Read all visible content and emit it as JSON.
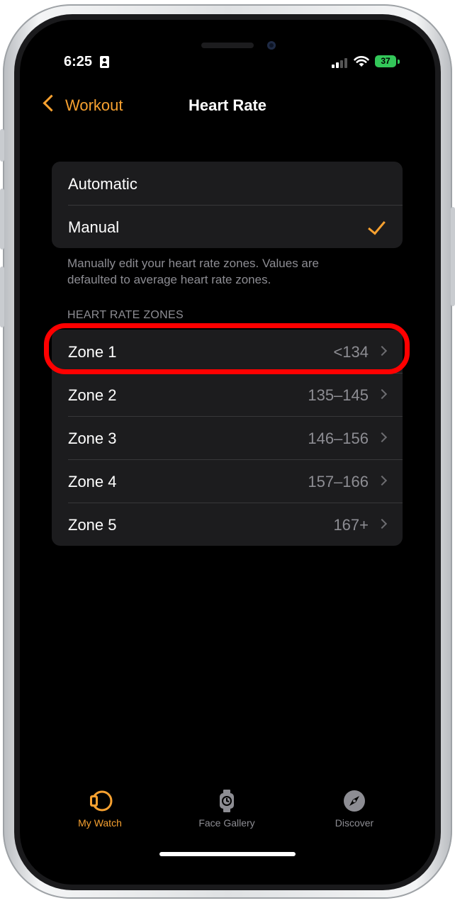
{
  "status_bar": {
    "time": "6:25",
    "battery": "37"
  },
  "nav": {
    "back_label": "Workout",
    "title": "Heart Rate"
  },
  "mode": {
    "options": [
      {
        "label": "Automatic",
        "selected": false
      },
      {
        "label": "Manual",
        "selected": true
      }
    ],
    "footer": "Manually edit your heart rate zones. Values are defaulted to average heart rate zones."
  },
  "zones": {
    "header": "HEART RATE ZONES",
    "items": [
      {
        "label": "Zone 1",
        "value": "<134"
      },
      {
        "label": "Zone 2",
        "value": "135–145"
      },
      {
        "label": "Zone 3",
        "value": "146–156"
      },
      {
        "label": "Zone 4",
        "value": "157–166"
      },
      {
        "label": "Zone 5",
        "value": "167+"
      }
    ]
  },
  "tab_bar": {
    "items": [
      {
        "label": "My Watch",
        "icon": "watch-icon",
        "active": true
      },
      {
        "label": "Face Gallery",
        "icon": "watch-face-icon",
        "active": false
      },
      {
        "label": "Discover",
        "icon": "compass-icon",
        "active": false
      }
    ]
  },
  "colors": {
    "accent": "#f7a130",
    "highlight": "#ff0000",
    "battery": "#33c759"
  }
}
